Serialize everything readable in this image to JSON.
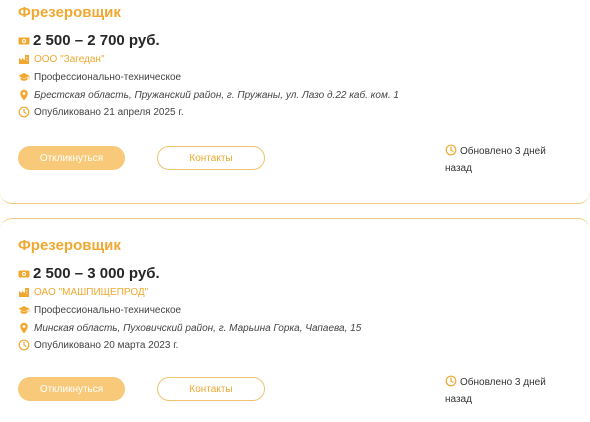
{
  "colors": {
    "accent": "#f0a830",
    "button_fill": "#f7c978",
    "divider": "#f0cc80"
  },
  "vacancies": [
    {
      "title": "Фрезеровщик",
      "salary": "2 500 – 2 700 руб.",
      "company": "ООО \"Загедан\"",
      "education": "Профессионально-техническое",
      "address": "Брестская область, Пружанский район, г. Пружаны, ул. Лазо д.22 каб. ком. 1",
      "published": "Опубликовано 21 апреля 2025 г.",
      "apply_label": "Откликнуться",
      "contacts_label": "Контакты",
      "updated": "Обновлено 3 дней назад"
    },
    {
      "title": "Фрезеровщик",
      "salary": "2 500 – 3 000 руб.",
      "company": "ОАО \"МАШПИЩЕПРОД\"",
      "education": "Профессионально-техническое",
      "address": "Минская область, Пуховичский район, г. Марьина Горка, Чапаева, 15",
      "published": "Опубликовано 20 марта 2023 г.",
      "apply_label": "Откликнуться",
      "contacts_label": "Контакты",
      "updated": "Обновлено 3 дней назад"
    }
  ],
  "icons": [
    "money-icon",
    "company-icon",
    "education-icon",
    "location-icon",
    "clock-icon"
  ]
}
